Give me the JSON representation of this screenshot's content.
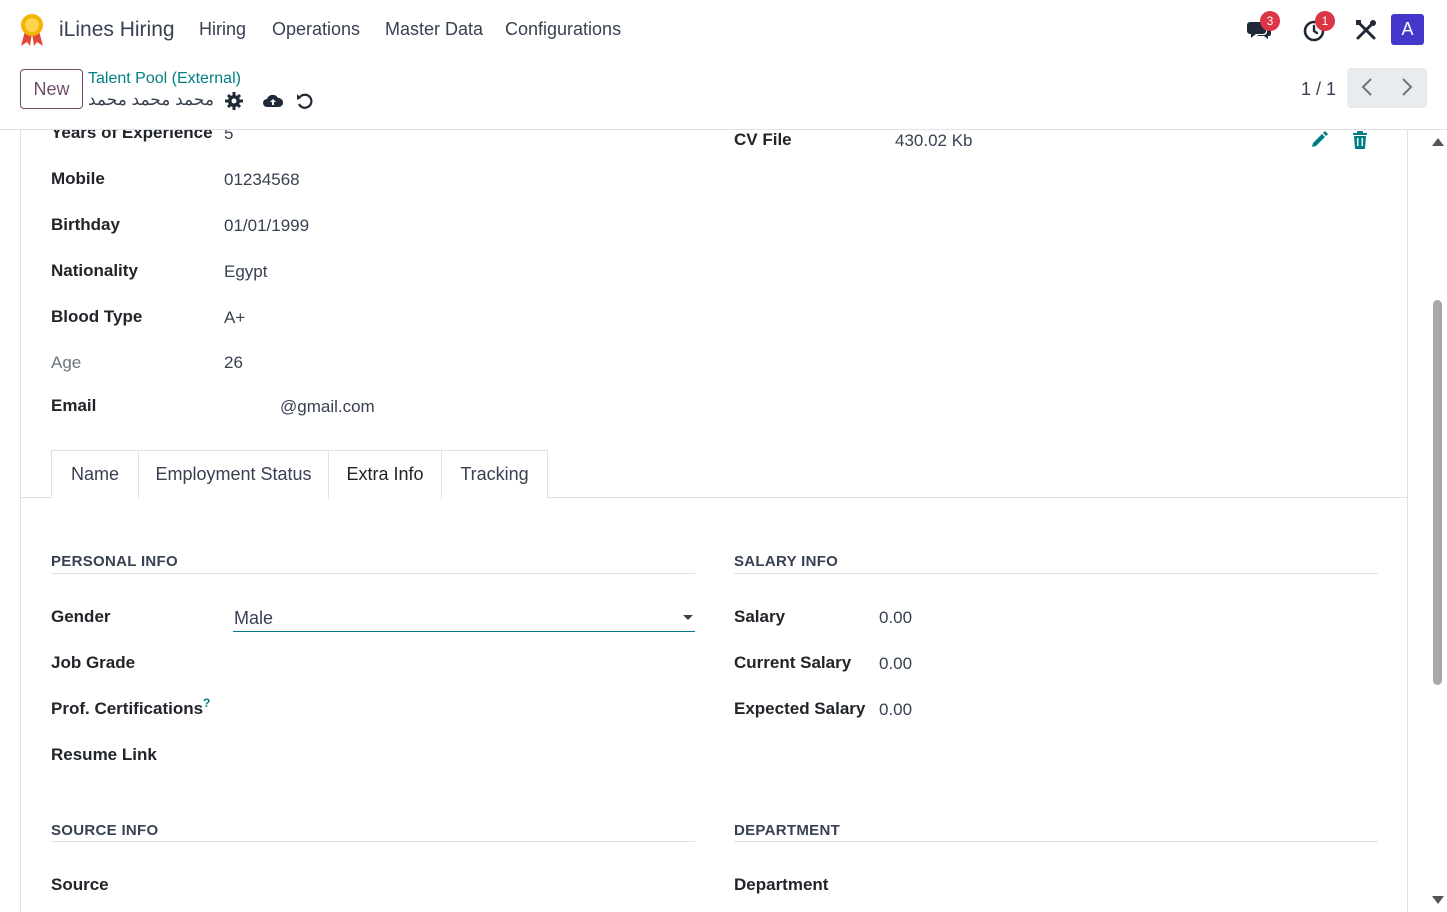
{
  "navbar": {
    "app_title": "iLines Hiring",
    "menus": [
      "Hiring",
      "Operations",
      "Master Data",
      "Configurations"
    ],
    "messages_badge": "3",
    "activities_badge": "1",
    "avatar_letter": "A"
  },
  "control_panel": {
    "new_label": "New",
    "breadcrumb": "Talent Pool (External)",
    "record_name": "محمد محمد محمد",
    "pager_value": "1 / 1"
  },
  "fields": {
    "years_exp": {
      "label": "Years of Experience",
      "value": "5"
    },
    "mobile": {
      "label": "Mobile",
      "value": "01234568"
    },
    "birthday": {
      "label": "Birthday",
      "value": "01/01/1999"
    },
    "nationality": {
      "label": "Nationality",
      "value": "Egypt"
    },
    "blood_type": {
      "label": "Blood Type",
      "value": "A+"
    },
    "age": {
      "label": "Age",
      "value": "26"
    },
    "email": {
      "label": "Email",
      "value": "@gmail.com"
    },
    "cv_file": {
      "label": "CV File",
      "value": "430.02 Kb"
    }
  },
  "tabs": [
    "Name",
    "Employment Status",
    "Extra Info",
    "Tracking"
  ],
  "active_tab": "Extra Info",
  "personal_info": {
    "title": "PERSONAL INFO",
    "gender_label": "Gender",
    "gender_value": "Male",
    "job_grade_label": "Job Grade",
    "prof_cert_label": "Prof. Certifications",
    "prof_cert_help": "?",
    "resume_link_label": "Resume Link"
  },
  "salary_info": {
    "title": "SALARY INFO",
    "salary_label": "Salary",
    "salary_value": "0.00",
    "current_salary_label": "Current Salary",
    "current_salary_value": "0.00",
    "expected_salary_label": "Expected Salary",
    "expected_salary_value": "0.00"
  },
  "source_info": {
    "title": "SOURCE INFO",
    "source_label": "Source"
  },
  "department": {
    "title": "DEPARTMENT",
    "department_label": "Department"
  },
  "colors": {
    "brand": "#714b67",
    "accent": "#017e84",
    "badge": "#dc3545",
    "avatar": "#4338ca"
  }
}
